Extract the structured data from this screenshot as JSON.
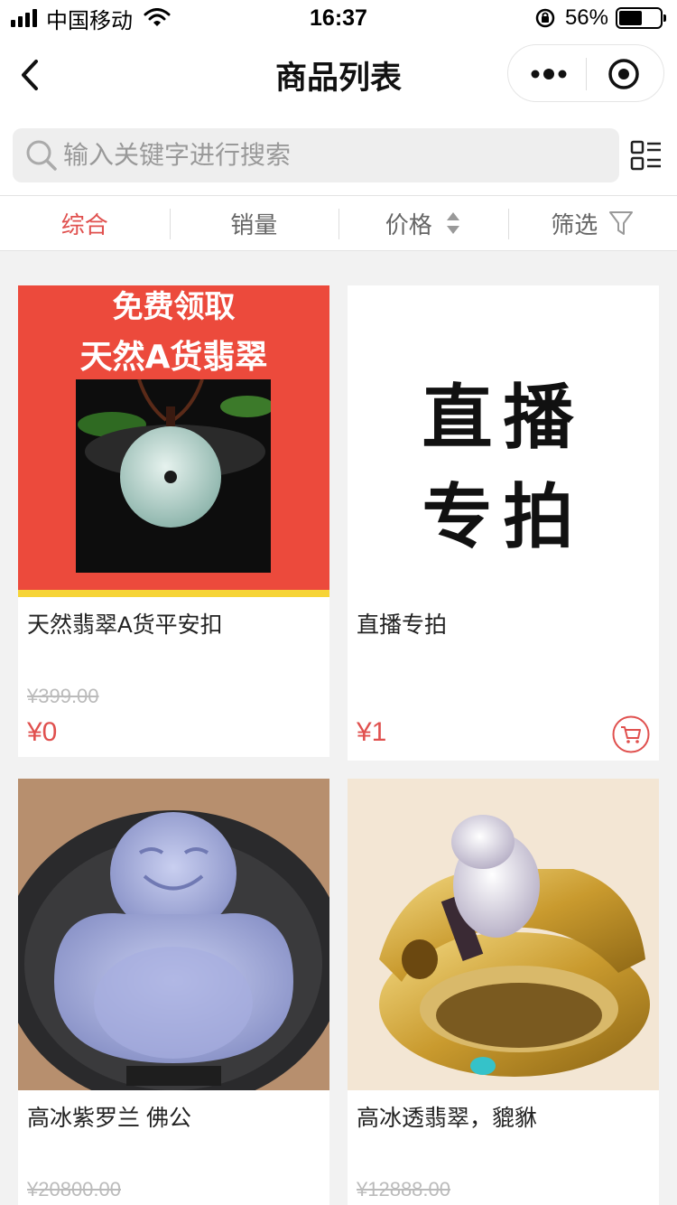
{
  "status_bar": {
    "carrier": "中国移动",
    "time": "16:37",
    "battery_percent": "56%",
    "battery_level": 0.56
  },
  "nav": {
    "title": "商品列表"
  },
  "search": {
    "placeholder": "输入关键字进行搜索",
    "value": ""
  },
  "filters": [
    {
      "label": "综合",
      "active": true
    },
    {
      "label": "销量",
      "active": false
    },
    {
      "label": "价格",
      "active": false
    },
    {
      "label": "筛选",
      "active": false
    }
  ],
  "products": [
    {
      "name": "天然翡翠A货平安扣",
      "original_price": "¥399.00",
      "price": "¥0",
      "image_text": [
        "免费领取",
        "天然A货翡翠"
      ]
    },
    {
      "name": "直播专拍",
      "original_price": "",
      "price": "¥1",
      "image_text": [
        "直播",
        "专拍"
      ]
    },
    {
      "name": "高冰紫罗兰 佛公",
      "original_price": "¥20800.00",
      "price": ""
    },
    {
      "name": "高冰透翡翠，貔貅",
      "original_price": "¥12888.00",
      "price": ""
    }
  ],
  "colors": {
    "accent": "#e0504e",
    "page_bg": "#f2f2f2"
  },
  "icons": [
    "back-arrow-icon",
    "more-dots-icon",
    "close-circle-icon",
    "search-icon",
    "list-layout-icon",
    "sort-arrows-icon",
    "funnel-icon",
    "cart-icon"
  ]
}
